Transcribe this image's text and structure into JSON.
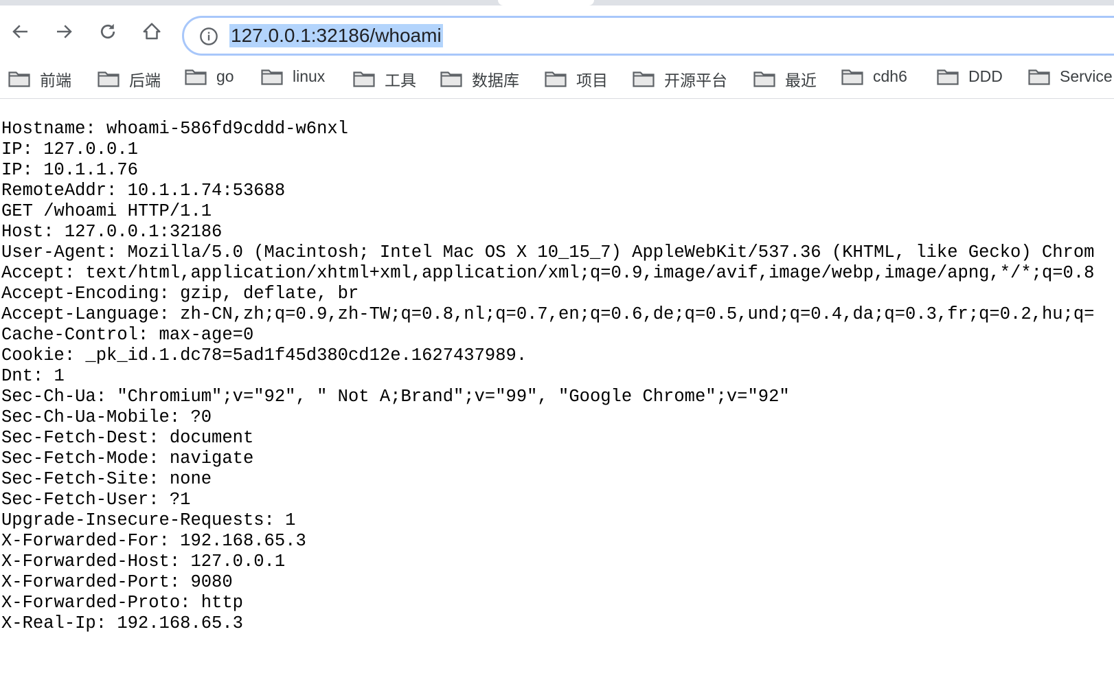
{
  "browser": {
    "url": "127.0.0.1:32186/whoami",
    "nav": [
      "back-icon",
      "forward-icon",
      "reload-icon",
      "home-icon"
    ],
    "bookmarks": [
      "前端",
      "后端",
      "go",
      "linux",
      "工具",
      "数据库",
      "项目",
      "开源平台",
      "最近",
      "cdh6",
      "DDD",
      "Service"
    ]
  },
  "content": {
    "lines": [
      "Hostname: whoami-586fd9cddd-w6nxl",
      "IP: 127.0.0.1",
      "IP: 10.1.1.76",
      "RemoteAddr: 10.1.1.74:53688",
      "GET /whoami HTTP/1.1",
      "Host: 127.0.0.1:32186",
      "User-Agent: Mozilla/5.0 (Macintosh; Intel Mac OS X 10_15_7) AppleWebKit/537.36 (KHTML, like Gecko) Chrom",
      "Accept: text/html,application/xhtml+xml,application/xml;q=0.9,image/avif,image/webp,image/apng,*/*;q=0.8",
      "Accept-Encoding: gzip, deflate, br",
      "Accept-Language: zh-CN,zh;q=0.9,zh-TW;q=0.8,nl;q=0.7,en;q=0.6,de;q=0.5,und;q=0.4,da;q=0.3,fr;q=0.2,hu;q=",
      "Cache-Control: max-age=0",
      "Cookie: _pk_id.1.dc78=5ad1f45d380cd12e.1627437989.",
      "Dnt: 1",
      "Sec-Ch-Ua: \"Chromium\";v=\"92\", \" Not A;Brand\";v=\"99\", \"Google Chrome\";v=\"92\"",
      "Sec-Ch-Ua-Mobile: ?0",
      "Sec-Fetch-Dest: document",
      "Sec-Fetch-Mode: navigate",
      "Sec-Fetch-Site: none",
      "Sec-Fetch-User: ?1",
      "Upgrade-Insecure-Requests: 1",
      "X-Forwarded-For: 192.168.65.3",
      "X-Forwarded-Host: 127.0.0.1",
      "X-Forwarded-Port: 9080",
      "X-Forwarded-Proto: http",
      "X-Real-Ip: 192.168.65.3"
    ]
  }
}
